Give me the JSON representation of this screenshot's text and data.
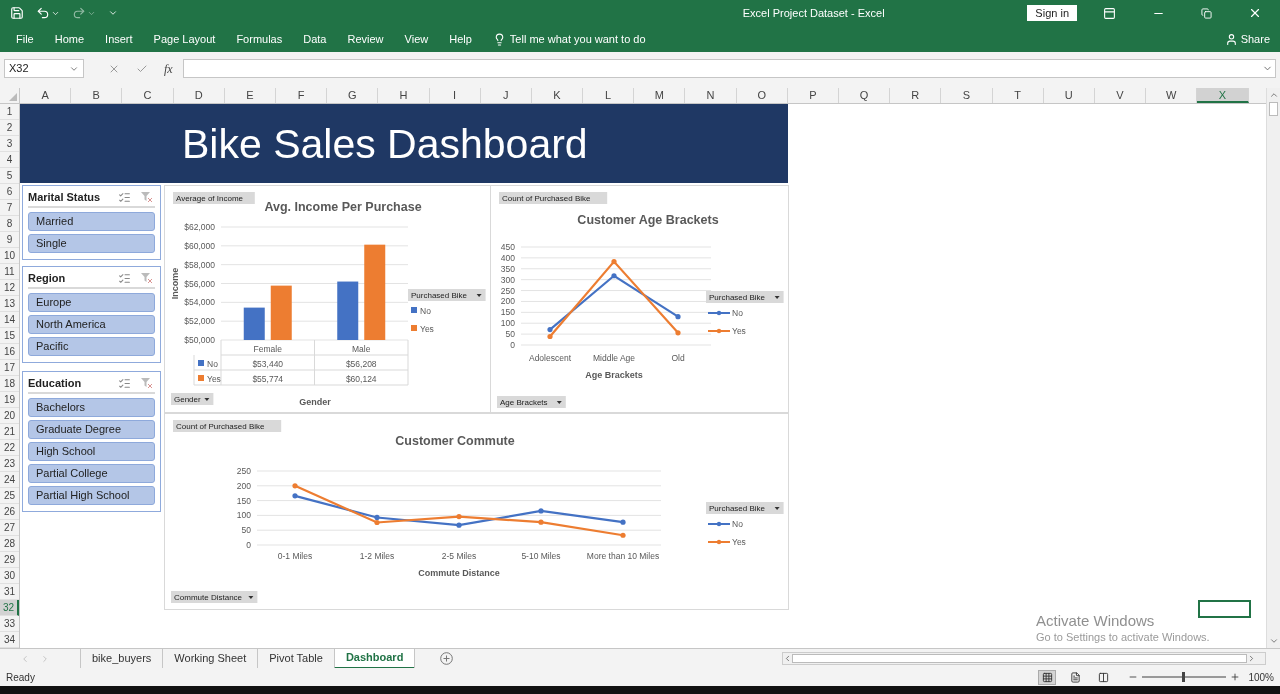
{
  "title_bar": {
    "title": "Excel Project Dataset - Excel",
    "sign_in": "Sign in"
  },
  "ribbon": {
    "tabs": [
      "File",
      "Home",
      "Insert",
      "Page Layout",
      "Formulas",
      "Data",
      "Review",
      "View",
      "Help"
    ],
    "tell_me": "Tell me what you want to do",
    "share": "Share"
  },
  "formula_bar": {
    "name_box": "X32",
    "function_label": "fx"
  },
  "columns": [
    {
      "label": "A",
      "selected": false
    },
    {
      "label": "B",
      "selected": false
    },
    {
      "label": "C",
      "selected": false
    },
    {
      "label": "D",
      "selected": false
    },
    {
      "label": "E",
      "selected": false
    },
    {
      "label": "F",
      "selected": false
    },
    {
      "label": "G",
      "selected": false
    },
    {
      "label": "H",
      "selected": false
    },
    {
      "label": "I",
      "selected": false
    },
    {
      "label": "J",
      "selected": false
    },
    {
      "label": "K",
      "selected": false
    },
    {
      "label": "L",
      "selected": false
    },
    {
      "label": "M",
      "selected": false
    },
    {
      "label": "N",
      "selected": false
    },
    {
      "label": "O",
      "selected": false
    },
    {
      "label": "P",
      "selected": false
    },
    {
      "label": "Q",
      "selected": false
    },
    {
      "label": "R",
      "selected": false
    },
    {
      "label": "S",
      "selected": false
    },
    {
      "label": "T",
      "selected": false
    },
    {
      "label": "U",
      "selected": false
    },
    {
      "label": "V",
      "selected": false
    },
    {
      "label": "W",
      "selected": false
    },
    {
      "label": "X",
      "selected": true
    }
  ],
  "rows": [
    {
      "label": "1",
      "selected": false
    },
    {
      "label": "2",
      "selected": false
    },
    {
      "label": "3",
      "selected": false
    },
    {
      "label": "4",
      "selected": false
    },
    {
      "label": "5",
      "selected": false
    },
    {
      "label": "6",
      "selected": false
    },
    {
      "label": "7",
      "selected": false
    },
    {
      "label": "8",
      "selected": false
    },
    {
      "label": "9",
      "selected": false
    },
    {
      "label": "10",
      "selected": false
    },
    {
      "label": "11",
      "selected": false
    },
    {
      "label": "12",
      "selected": false
    },
    {
      "label": "13",
      "selected": false
    },
    {
      "label": "14",
      "selected": false
    },
    {
      "label": "15",
      "selected": false
    },
    {
      "label": "16",
      "selected": false
    },
    {
      "label": "17",
      "selected": false
    },
    {
      "label": "18",
      "selected": false
    },
    {
      "label": "19",
      "selected": false
    },
    {
      "label": "20",
      "selected": false
    },
    {
      "label": "21",
      "selected": false
    },
    {
      "label": "22",
      "selected": false
    },
    {
      "label": "23",
      "selected": false
    },
    {
      "label": "24",
      "selected": false
    },
    {
      "label": "25",
      "selected": false
    },
    {
      "label": "26",
      "selected": false
    },
    {
      "label": "27",
      "selected": false
    },
    {
      "label": "28",
      "selected": false
    },
    {
      "label": "29",
      "selected": false
    },
    {
      "label": "30",
      "selected": false
    },
    {
      "label": "31",
      "selected": false
    },
    {
      "label": "32",
      "selected": true
    },
    {
      "label": "33",
      "selected": false
    },
    {
      "label": "34",
      "selected": false
    }
  ],
  "banner": {
    "title": "Bike Sales Dashboard"
  },
  "slicers": [
    {
      "title": "Marital Status",
      "items": [
        {
          "label": "Married",
          "selected": true
        },
        {
          "label": "Single",
          "selected": true
        }
      ]
    },
    {
      "title": "Region",
      "items": [
        {
          "label": "Europe",
          "selected": true
        },
        {
          "label": "North America",
          "selected": true
        },
        {
          "label": "Pacific",
          "selected": true
        }
      ]
    },
    {
      "title": "Education",
      "items": [
        {
          "label": "Bachelors",
          "selected": true
        },
        {
          "label": "Graduate Degree",
          "selected": true
        },
        {
          "label": "High School",
          "selected": true
        },
        {
          "label": "Partial College",
          "selected": true
        },
        {
          "label": "Partial High School",
          "selected": true
        }
      ]
    }
  ],
  "charts": [
    {
      "value_button": "Average of Income",
      "axis_button": "Gender",
      "legend_title": "Purchased Bike",
      "chart_data": {
        "type": "bar",
        "grid": true,
        "legend": true,
        "title": "Avg. Income Per Purchase",
        "xlabel": "Gender",
        "ylabel": "Income",
        "categories": [
          "Female",
          "Male"
        ],
        "series": [
          {
            "name": "No",
            "color": "#4472c4",
            "values": [
              53440,
              56208
            ]
          },
          {
            "name": "Yes",
            "color": "#ed7d31",
            "values": [
              55774,
              60124
            ]
          }
        ],
        "ylim": [
          50000,
          62000
        ],
        "yticks": [
          {
            "value": 50000,
            "label": "$50,000"
          },
          {
            "value": 52000,
            "label": "$52,000"
          },
          {
            "value": 54000,
            "label": "$54,000"
          },
          {
            "value": 56000,
            "label": "$56,000"
          },
          {
            "value": 58000,
            "label": "$58,000"
          },
          {
            "value": 60000,
            "label": "$60,000"
          },
          {
            "value": 62000,
            "label": "$62,000"
          }
        ]
      },
      "data_table": [
        {
          "label": "No",
          "cells": [
            "$53,440",
            "$56,208"
          ]
        },
        {
          "label": "Yes",
          "cells": [
            "$55,774",
            "$60,124"
          ]
        }
      ]
    },
    {
      "value_button": "Count of Purchased Bike",
      "axis_button": "Age Brackets",
      "legend_title": "Purchased Bike",
      "chart_data": {
        "type": "line",
        "grid": true,
        "legend": true,
        "title": "Customer Age Brackets",
        "xlabel": "Age Brackets",
        "categories": [
          "Adolescent",
          "Middle Age",
          "Old"
        ],
        "series": [
          {
            "name": "No",
            "color": "#4472c4",
            "values": [
              71,
              318,
              130
            ]
          },
          {
            "name": "Yes",
            "color": "#ed7d31",
            "values": [
              39,
              383,
              56
            ]
          }
        ],
        "ylim": [
          0,
          450
        ],
        "yticks": [
          0,
          50,
          100,
          150,
          200,
          250,
          300,
          350,
          400,
          450
        ]
      }
    },
    {
      "value_button": "Count of Purchased Bike",
      "axis_button": "Commute Distance",
      "legend_title": "Purchased Bike",
      "chart_data": {
        "type": "line",
        "grid": true,
        "legend": true,
        "title": "Customer Commute",
        "xlabel": "Commute Distance",
        "categories": [
          "0-1 Miles",
          "1-2 Miles",
          "2-5 Miles",
          "5-10 Miles",
          "More than 10 Miles"
        ],
        "series": [
          {
            "name": "No",
            "color": "#4472c4",
            "values": [
              166,
              93,
              67,
              115,
              77
            ]
          },
          {
            "name": "Yes",
            "color": "#ed7d31",
            "values": [
              200,
              76,
              96,
              77,
              33
            ]
          }
        ],
        "ylim": [
          0,
          250
        ],
        "yticks": [
          0,
          50,
          100,
          150,
          200,
          250
        ]
      }
    }
  ],
  "sheet_tabs": [
    {
      "label": "bike_buyers",
      "selected": false
    },
    {
      "label": "Working Sheet",
      "selected": false
    },
    {
      "label": "Pivot Table",
      "selected": false
    },
    {
      "label": "Dashboard",
      "selected": true
    }
  ],
  "status_bar": {
    "status": "Ready",
    "view_buttons": [
      {
        "kind": "normal",
        "selected": true
      },
      {
        "kind": "page_layout",
        "selected": false
      },
      {
        "kind": "page_break",
        "selected": false
      }
    ],
    "zoom_slider": {
      "level": 0.5
    },
    "zoom": "100%"
  },
  "activation_notice": {
    "title": "Activate Windows",
    "text": "Go to Settings to activate Windows."
  }
}
